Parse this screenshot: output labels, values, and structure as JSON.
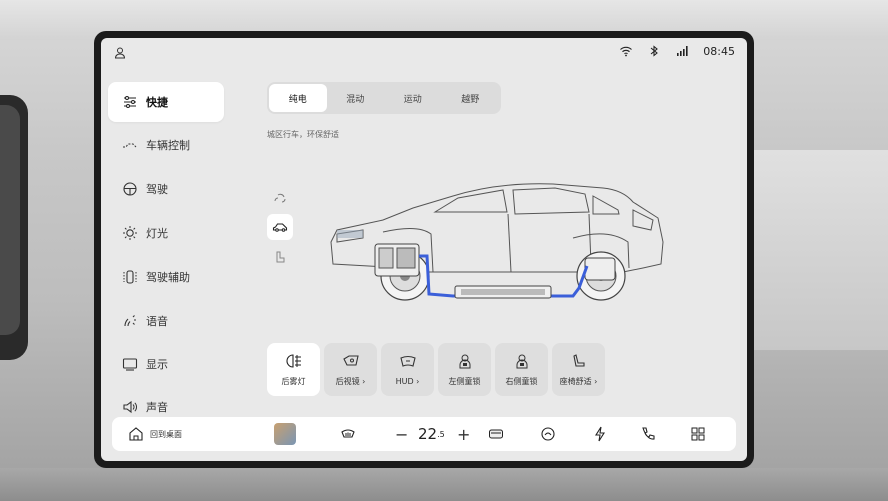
{
  "status": {
    "time": "08:45"
  },
  "sidebar": {
    "items": [
      {
        "label": "快捷",
        "icon": "sliders-icon",
        "active": true
      },
      {
        "label": "车辆控制",
        "icon": "vehicle-control-icon",
        "active": false
      },
      {
        "label": "驾驶",
        "icon": "steering-wheel-icon",
        "active": false
      },
      {
        "label": "灯光",
        "icon": "light-icon",
        "active": false
      },
      {
        "label": "驾驶辅助",
        "icon": "driver-assist-icon",
        "active": false
      },
      {
        "label": "语音",
        "icon": "voice-icon",
        "active": false
      },
      {
        "label": "显示",
        "icon": "display-icon",
        "active": false
      },
      {
        "label": "声音",
        "icon": "speaker-icon",
        "active": false
      }
    ]
  },
  "modes": {
    "items": [
      "纯电",
      "混动",
      "运动",
      "越野"
    ],
    "active": "纯电",
    "description": "城区行车，环保舒适"
  },
  "shortcuts": [
    {
      "label": "后雾灯",
      "icon": "rear-fog-light-icon",
      "active": true
    },
    {
      "label": "后视镜 ›",
      "icon": "mirror-icon",
      "active": false
    },
    {
      "label": "HUD ›",
      "icon": "hud-icon",
      "active": false
    },
    {
      "label": "左侧童锁",
      "icon": "child-lock-left-icon",
      "active": false
    },
    {
      "label": "右侧童锁",
      "icon": "child-lock-right-icon",
      "active": false
    },
    {
      "label": "座椅舒适 ›",
      "icon": "seat-icon",
      "active": false
    }
  ],
  "dock": {
    "home_label": "回到桌面",
    "temperature": "22",
    "temperature_decimal": "5",
    "minus": "−",
    "plus": "+"
  },
  "colors": {
    "accent_blue": "#3b5fd9",
    "active_bg": "#ffffff",
    "screen_bg": "#e9e9e9"
  }
}
